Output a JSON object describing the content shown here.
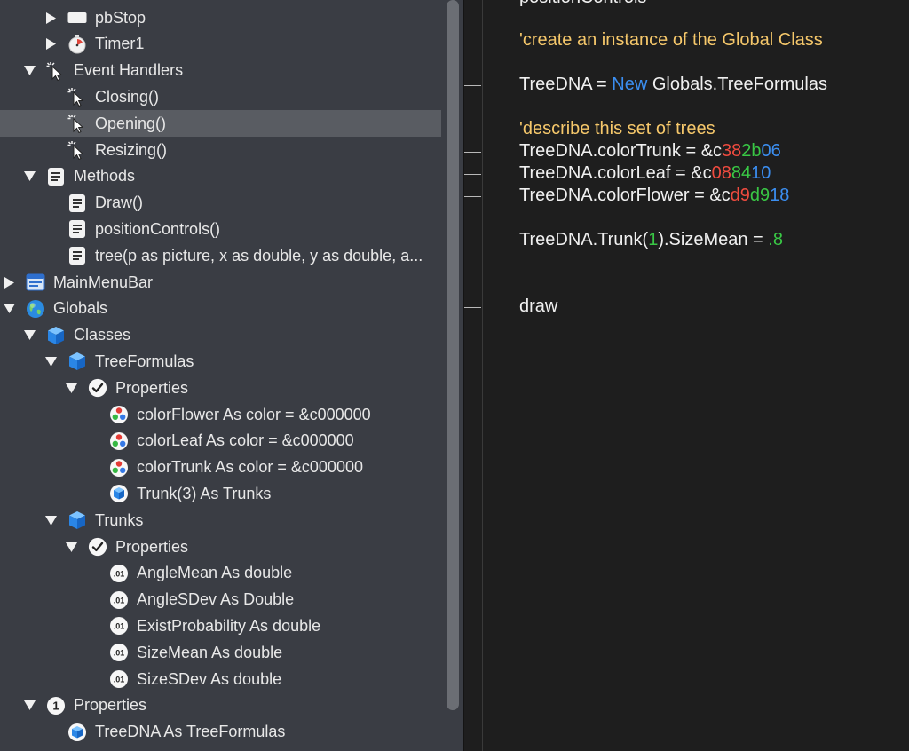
{
  "navigator": {
    "items": [
      {
        "label": "pbStop",
        "icon": "button-icon",
        "depth": 2,
        "expander": "collapsed"
      },
      {
        "label": "Timer1",
        "icon": "timer-icon",
        "depth": 2,
        "expander": "collapsed"
      },
      {
        "label": "Event Handlers",
        "icon": "event-cursor-icon",
        "depth": 1,
        "expander": "expanded"
      },
      {
        "label": "Closing()",
        "icon": "event-cursor-icon",
        "depth": 2,
        "expander": "none"
      },
      {
        "label": "Opening()",
        "icon": "event-cursor-icon",
        "depth": 2,
        "expander": "none",
        "selected": true
      },
      {
        "label": "Resizing()",
        "icon": "event-cursor-icon",
        "depth": 2,
        "expander": "none"
      },
      {
        "label": "Methods",
        "icon": "method-icon",
        "depth": 1,
        "expander": "expanded"
      },
      {
        "label": "Draw()",
        "icon": "method-icon",
        "depth": 2,
        "expander": "none"
      },
      {
        "label": "positionControls()",
        "icon": "method-icon",
        "depth": 2,
        "expander": "none"
      },
      {
        "label": "tree(p as picture, x as double, y as double, a...",
        "icon": "method-icon",
        "depth": 2,
        "expander": "none"
      },
      {
        "label": "MainMenuBar",
        "icon": "menubar-icon",
        "depth": 0,
        "expander": "collapsed"
      },
      {
        "label": "Globals",
        "icon": "globe-icon",
        "depth": 0,
        "expander": "expanded"
      },
      {
        "label": "Classes",
        "icon": "class-cube-icon",
        "depth": 1,
        "expander": "expanded"
      },
      {
        "label": "TreeFormulas",
        "icon": "class-cube-icon",
        "depth": 2,
        "expander": "expanded"
      },
      {
        "label": "Properties",
        "icon": "checkmark-icon",
        "depth": 3,
        "expander": "expanded"
      },
      {
        "label": "colorFlower As color = &c000000",
        "icon": "color-property-icon",
        "depth": 4,
        "expander": "none"
      },
      {
        "label": "colorLeaf As color = &c000000",
        "icon": "color-property-icon",
        "depth": 4,
        "expander": "none"
      },
      {
        "label": "colorTrunk As color = &c000000",
        "icon": "color-property-icon",
        "depth": 4,
        "expander": "none"
      },
      {
        "label": "Trunk(3) As Trunks",
        "icon": "object-property-icon",
        "depth": 4,
        "expander": "none"
      },
      {
        "label": "Trunks",
        "icon": "class-cube-icon",
        "depth": 2,
        "expander": "expanded"
      },
      {
        "label": "Properties",
        "icon": "checkmark-icon",
        "depth": 3,
        "expander": "expanded"
      },
      {
        "label": "AngleMean As double",
        "icon": "double-property-icon",
        "depth": 4,
        "expander": "none"
      },
      {
        "label": "AngleSDev As Double",
        "icon": "double-property-icon",
        "depth": 4,
        "expander": "none"
      },
      {
        "label": "ExistProbability As double",
        "icon": "double-property-icon",
        "depth": 4,
        "expander": "none"
      },
      {
        "label": "SizeMean As double",
        "icon": "double-property-icon",
        "depth": 4,
        "expander": "none"
      },
      {
        "label": "SizeSDev As double",
        "icon": "double-property-icon",
        "depth": 4,
        "expander": "none"
      },
      {
        "label": "Properties",
        "icon": "count-badge-icon",
        "badge": "1",
        "depth": 1,
        "expander": "expanded"
      },
      {
        "label": "TreeDNA As TreeFormulas",
        "icon": "object-property-icon",
        "depth": 2,
        "expander": "none"
      }
    ],
    "double_icon_text": ".01"
  },
  "editor": {
    "lines": [
      {
        "id": "l0",
        "segments": [
          {
            "t": "positionControls",
            "c": "plain"
          }
        ]
      },
      {
        "id": "l1",
        "segments": [
          {
            "t": "'create an instance of the Global Class",
            "c": "comment"
          }
        ]
      },
      {
        "id": "l2",
        "segments": [
          {
            "t": "TreeDNA = ",
            "c": "plain"
          },
          {
            "t": "New",
            "c": "kw"
          },
          {
            "t": " Globals.TreeFormulas",
            "c": "plain"
          }
        ]
      },
      {
        "id": "l3",
        "segments": [
          {
            "t": "'describe this set of trees",
            "c": "comment"
          }
        ]
      },
      {
        "id": "l4",
        "segments": [
          {
            "t": "TreeDNA.colorTrunk = &c",
            "c": "plain"
          },
          {
            "t": "38",
            "c": "red"
          },
          {
            "t": "2b",
            "c": "green"
          },
          {
            "t": "06",
            "c": "blue"
          }
        ]
      },
      {
        "id": "l5",
        "segments": [
          {
            "t": "TreeDNA.colorLeaf = &c",
            "c": "plain"
          },
          {
            "t": "08",
            "c": "red"
          },
          {
            "t": "84",
            "c": "green"
          },
          {
            "t": "10",
            "c": "blue"
          }
        ]
      },
      {
        "id": "l6",
        "segments": [
          {
            "t": "TreeDNA.colorFlower = &c",
            "c": "plain"
          },
          {
            "t": "d9",
            "c": "red"
          },
          {
            "t": "d9",
            "c": "green"
          },
          {
            "t": "18",
            "c": "blue"
          }
        ]
      },
      {
        "id": "l7",
        "segments": [
          {
            "t": "TreeDNA.Trunk(",
            "c": "plain"
          },
          {
            "t": "1",
            "c": "green"
          },
          {
            "t": ").SizeMean = ",
            "c": "plain"
          },
          {
            "t": ".8",
            "c": "green"
          }
        ]
      },
      {
        "id": "l8",
        "segments": [
          {
            "t": "draw",
            "c": "plain"
          }
        ]
      }
    ],
    "colors": {
      "comment": "#f6c86b",
      "keyword": "#3b8ef0",
      "red": "#ef4b3f",
      "green": "#39c845",
      "blue": "#3b8ef0"
    }
  }
}
